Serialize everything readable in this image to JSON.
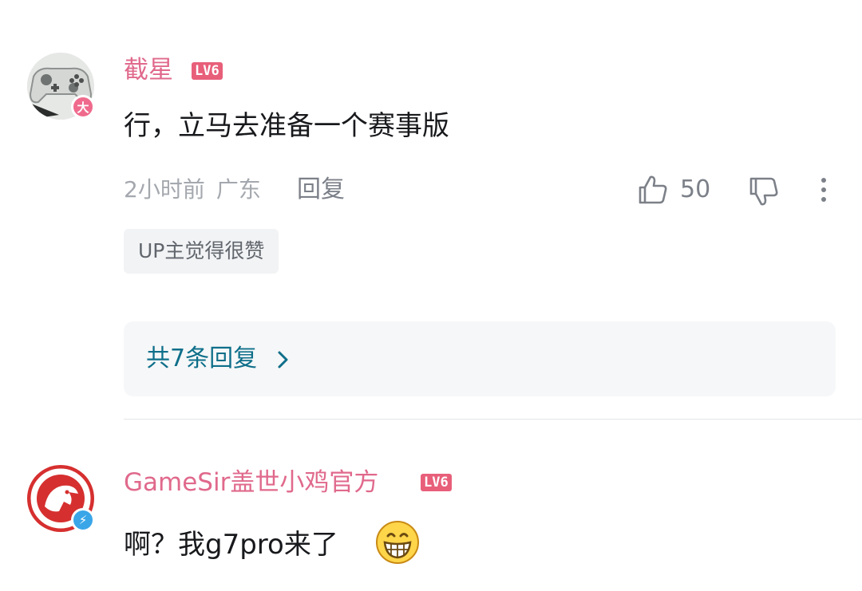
{
  "comments": [
    {
      "username": "截星",
      "level": "LV6",
      "avatar_badge": "大",
      "text": "行，立马去准备一个赛事版",
      "time": "2小时前",
      "location": "广东",
      "reply_label": "回复",
      "likes": "50",
      "up_tag": "UP主觉得很赞",
      "replies_summary": "共7条回复"
    },
    {
      "username": "GameSir盖世小鸡官方",
      "level": "LV6",
      "avatar_badge": "⚡",
      "text": "啊？我g7pro来了"
    }
  ],
  "icons": {
    "like": "thumbs-up-icon",
    "dislike": "thumbs-down-icon",
    "more": "more-vertical-icon",
    "chevron": "chevron-right-icon",
    "emoji": "grinning-face-icon"
  },
  "colors": {
    "username": "#e0698c",
    "level_badge": "#e85f7a",
    "replies_link": "#0e6f8a",
    "meta_text": "#a4a8ae"
  }
}
